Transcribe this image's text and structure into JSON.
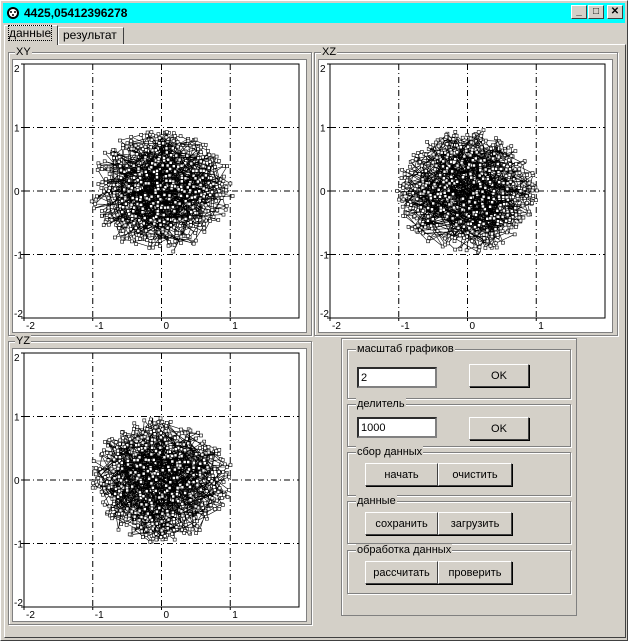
{
  "window": {
    "title": "4425,05412396278"
  },
  "titlebar_buttons": {
    "minimize": "_",
    "maximize": "□",
    "close": "✕"
  },
  "tabs": [
    {
      "label": "данные",
      "active": true
    },
    {
      "label": "результат",
      "active": false
    }
  ],
  "plots": {
    "xy": {
      "title": "XY"
    },
    "xz": {
      "title": "XZ"
    },
    "yz": {
      "title": "YZ"
    }
  },
  "chart_data": [
    {
      "type": "scatter",
      "title": "XY",
      "xlim": [
        -2,
        2
      ],
      "ylim": [
        -2,
        2
      ],
      "xticks": [
        "-2",
        "-1",
        "0",
        "1"
      ],
      "yticks": [
        "2",
        "1",
        "0",
        "-1",
        "-2"
      ],
      "grid": true,
      "cluster": {
        "cx": 0,
        "cy": 0,
        "rx": 1.05,
        "ry": 1.0,
        "points": 520
      }
    },
    {
      "type": "scatter",
      "title": "XZ",
      "xlim": [
        -2,
        2
      ],
      "ylim": [
        -2,
        2
      ],
      "xticks": [
        "-2",
        "-1",
        "0",
        "1"
      ],
      "yticks": [
        "2",
        "1",
        "0",
        "-1",
        "-2"
      ],
      "grid": true,
      "cluster": {
        "cx": 0,
        "cy": 0,
        "rx": 1.05,
        "ry": 1.0,
        "points": 520
      }
    },
    {
      "type": "scatter",
      "title": "YZ",
      "xlim": [
        -2,
        2
      ],
      "ylim": [
        -2,
        2
      ],
      "xticks": [
        "-2",
        "-1",
        "0",
        "1"
      ],
      "yticks": [
        "2",
        "1",
        "0",
        "-1",
        "-2"
      ],
      "grid": true,
      "cluster": {
        "cx": 0,
        "cy": 0,
        "rx": 1.05,
        "ry": 1.0,
        "points": 520
      }
    }
  ],
  "controls": {
    "scale": {
      "caption": "масштаб графиков",
      "value": "2",
      "ok_label": "OK"
    },
    "divider": {
      "caption": "делитель",
      "value": "1000",
      "ok_label": "OK"
    },
    "collect": {
      "caption": "сбор данных",
      "start_label": "начать",
      "clear_label": "очистить"
    },
    "data": {
      "caption": "данные",
      "save_label": "сохранить",
      "load_label": "загрузить"
    },
    "processing": {
      "caption": "обработка данных",
      "calc_label": "рассчитать",
      "check_label": "проверить"
    }
  }
}
